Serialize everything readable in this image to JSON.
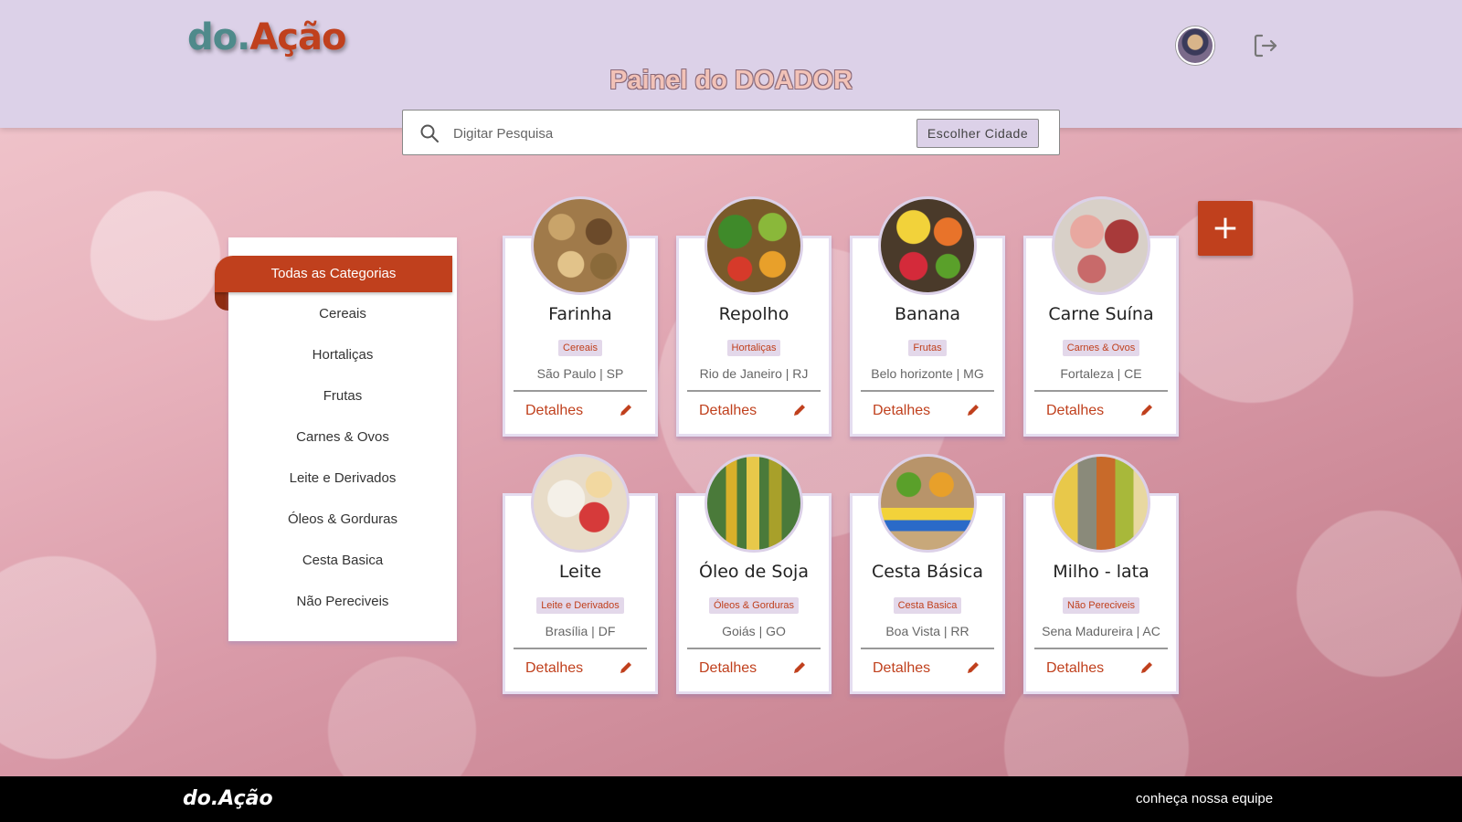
{
  "header": {
    "logo_part1": "do.",
    "logo_part2": "Ação",
    "panel_title": "Painel do DOADOR",
    "avatar_icon": "user-avatar",
    "logout_icon": "logout-icon"
  },
  "search": {
    "placeholder": "Digitar Pesquisa",
    "value": "",
    "city_button": "Escolher Cidade",
    "icon": "search-icon"
  },
  "sidebar": {
    "active": "Todas as Categorias",
    "items": [
      "Cereais",
      "Hortaliças",
      "Frutas",
      "Carnes & Ovos",
      "Leite e Derivados",
      "Óleos & Gorduras",
      "Cesta Basica",
      "Não Pereciveis"
    ]
  },
  "cards": [
    {
      "title": "Farinha",
      "tag": "Cereais",
      "location": "São Paulo | SP",
      "details": "Detalhes",
      "image": "grains"
    },
    {
      "title": "Repolho",
      "tag": "Hortaliças",
      "location": "Rio de Janeiro | RJ",
      "details": "Detalhes",
      "image": "vegetables"
    },
    {
      "title": "Banana",
      "tag": "Frutas",
      "location": "Belo horizonte | MG",
      "details": "Detalhes",
      "image": "fruits"
    },
    {
      "title": "Carne Suína",
      "tag": "Carnes & Ovos",
      "location": "Fortaleza | CE",
      "details": "Detalhes",
      "image": "meat"
    },
    {
      "title": "Leite",
      "tag": "Leite e Derivados",
      "location": "Brasília | DF",
      "details": "Detalhes",
      "image": "dairy"
    },
    {
      "title": "Óleo de Soja",
      "tag": "Óleos & Gorduras",
      "location": "Goiás | GO",
      "details": "Detalhes",
      "image": "oils"
    },
    {
      "title": "Cesta Básica",
      "tag": "Cesta Basica",
      "location": "Boa Vista | RR",
      "details": "Detalhes",
      "image": "food-basket"
    },
    {
      "title": "Milho - lata",
      "tag": "Não Pereciveis",
      "location": "Sena Madureira | AC",
      "details": "Detalhes",
      "image": "canned-goods"
    }
  ],
  "add_button": "+",
  "footer": {
    "logo": "do.Ação",
    "team_link": "conheça nossa equipe"
  },
  "colors": {
    "accent": "#c0401d",
    "header_bg": "#dcd1e8",
    "logo_teal": "#4f8a8b"
  }
}
